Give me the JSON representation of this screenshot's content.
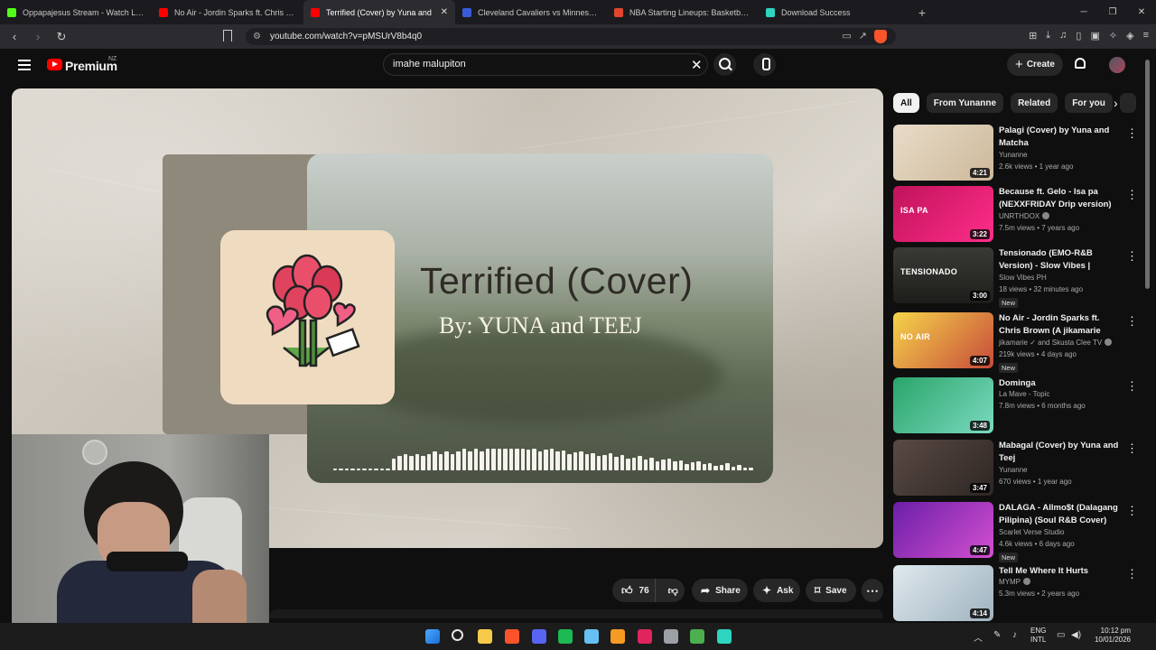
{
  "browser": {
    "tabs": [
      {
        "title": "Oppapajesus Stream - Watch Live on",
        "color": "#53fc18"
      },
      {
        "title": "No Air - Jordin Sparks ft. Chris Brown",
        "color": "#ff0000"
      },
      {
        "title": "Terrified (Cover) by Yuna and",
        "color": "#ff0000"
      },
      {
        "title": "Cleveland Cavaliers vs Minnesota Tim",
        "color": "#3a5bd9"
      },
      {
        "title": "NBA Starting Lineups: Basketball Dai",
        "color": "#e0462c"
      },
      {
        "title": "Download Success",
        "color": "#2dd4bf"
      }
    ],
    "url": "youtube.com/watch?v=pMSUrV8b4q0"
  },
  "youtube": {
    "brand": "Premium",
    "region": "NZ",
    "search_value": "imahe malupiton",
    "create_label": "Create"
  },
  "video": {
    "title_art": "Terrified (Cover)",
    "subtitle_art": "By: YUNA and TEEJ",
    "likes": "76",
    "share_label": "Share",
    "ask_label": "Ask",
    "save_label": "Save"
  },
  "chips": [
    "All",
    "From Yunanne",
    "Related",
    "For you"
  ],
  "recommendations": [
    {
      "title": "Palagi (Cover) by Yuna and Matcha",
      "channel": "Yunanne",
      "verified": false,
      "meta": "2.6k views • 1 year ago",
      "duration": "4:21",
      "badge": "",
      "thumb_label": "",
      "thumb_bg": "linear-gradient(135deg,#e8dcc8,#cdb89a)"
    },
    {
      "title": "Because ft. Gelo - Isa pa (NEXXFRIDAY Drip version)",
      "channel": "UNRTHDOX",
      "verified": true,
      "meta": "7.5m views • 7 years ago",
      "duration": "3:22",
      "badge": "",
      "thumb_label": "ISA PA",
      "thumb_bg": "linear-gradient(135deg,#c0135a,#ff2d8a)"
    },
    {
      "title": "Tensionado (EMO-R&B Version) - Slow Vibes | Soapdish",
      "channel": "Slow Vibes PH",
      "verified": false,
      "meta": "18 views • 32 minutes ago",
      "duration": "3:00",
      "badge": "New",
      "thumb_label": "TENSIONADO",
      "thumb_bg": "linear-gradient(180deg,#3a3a35,#1d1d1a)"
    },
    {
      "title": "No Air - Jordin Sparks ft. Chris Brown (A jikamarie Cover ft. ...",
      "channel": "jikamarie ✓ and Skusta Clee TV",
      "verified": true,
      "meta": "219k views • 4 days ago",
      "duration": "4:07",
      "badge": "New",
      "thumb_label": "NO AIR",
      "thumb_bg": "linear-gradient(135deg,#f5d44a,#c74a3a)"
    },
    {
      "title": "Dominga",
      "channel": "La Mave - Topic",
      "verified": false,
      "meta": "7.8m views • 6 months ago",
      "duration": "3:48",
      "badge": "",
      "thumb_label": "",
      "thumb_bg": "linear-gradient(135deg,#2aa56a,#7bd9c0)"
    },
    {
      "title": "Mabagal (Cover) by Yuna and Teej",
      "channel": "Yunanne",
      "verified": false,
      "meta": "670 views • 1 year ago",
      "duration": "3:47",
      "badge": "",
      "thumb_label": "",
      "thumb_bg": "linear-gradient(135deg,#5a4a45,#2e2623)"
    },
    {
      "title": "DALAGA - Allmo$t (Dalagang Pilipina) (Soul R&B Cover)",
      "channel": "Scarlet Verse Studio",
      "verified": false,
      "meta": "4.6k views • 6 days ago",
      "duration": "4:47",
      "badge": "New",
      "thumb_label": "",
      "thumb_bg": "linear-gradient(135deg,#6b1fa8,#d44fd0)"
    },
    {
      "title": "Tell Me Where It Hurts",
      "channel": "MYMP",
      "verified": true,
      "meta": "5.3m views • 2 years ago",
      "duration": "4:14",
      "badge": "",
      "thumb_label": "",
      "thumb_bg": "linear-gradient(135deg,#dfe8ee,#9fb3bf)"
    }
  ],
  "taskbar": {
    "lang": "ENG",
    "layout": "INTL",
    "time": "10:12 pm",
    "date": "10/01/2026"
  }
}
